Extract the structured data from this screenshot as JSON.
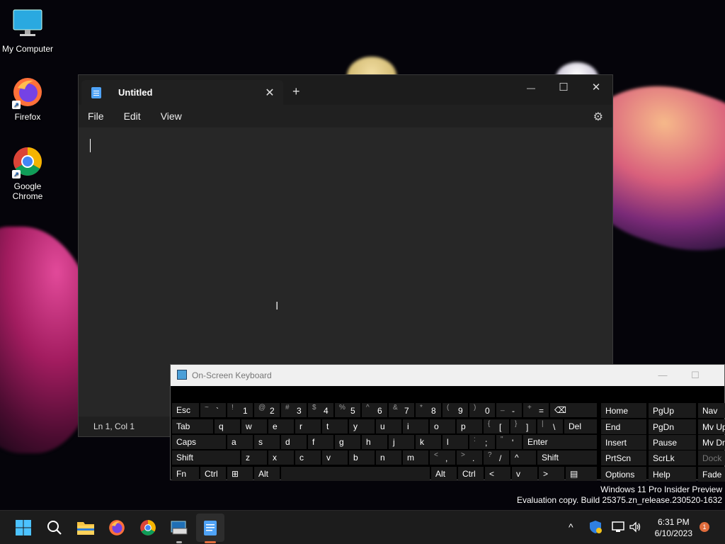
{
  "colors": {
    "accent": "#4fa3f7",
    "taskbar": "#1c1c1c",
    "notepad_bg": "#202020",
    "osk_key": "#1b1b1b"
  },
  "desktop": {
    "icons": [
      {
        "label": "My Computer",
        "icon": "monitor-icon"
      },
      {
        "label": "Firefox",
        "icon": "firefox-icon"
      },
      {
        "label": "Google Chrome",
        "icon": "chrome-icon"
      }
    ]
  },
  "notepad": {
    "tab_title": "Untitled",
    "tab_close": "✕",
    "new_tab": "+",
    "window_controls": {
      "minimize": "—",
      "maximize": "☐",
      "close": "✕"
    },
    "menu": [
      "File",
      "Edit",
      "View"
    ],
    "settings_icon": "⚙",
    "status": "Ln 1, Col 1"
  },
  "osk": {
    "title": "On-Screen Keyboard",
    "title_buttons": {
      "minimize": "—",
      "maximize": "☐"
    },
    "rows": {
      "r1": [
        {
          "main": "Esc"
        },
        {
          "shift": "~",
          "low": "`"
        },
        {
          "shift": "!",
          "low": "1"
        },
        {
          "shift": "@",
          "low": "2"
        },
        {
          "shift": "#",
          "low": "3"
        },
        {
          "shift": "$",
          "low": "4"
        },
        {
          "shift": "%",
          "low": "5"
        },
        {
          "shift": "^",
          "low": "6"
        },
        {
          "shift": "&",
          "low": "7"
        },
        {
          "shift": "*",
          "low": "8"
        },
        {
          "shift": "(",
          "low": "9"
        },
        {
          "shift": ")",
          "low": "0"
        },
        {
          "shift": "_",
          "low": "-"
        },
        {
          "shift": "+",
          "low": "="
        },
        {
          "main": "⌫"
        }
      ],
      "r2": [
        {
          "main": "Tab"
        },
        {
          "main": "q"
        },
        {
          "main": "w"
        },
        {
          "main": "e"
        },
        {
          "main": "r"
        },
        {
          "main": "t"
        },
        {
          "main": "y"
        },
        {
          "main": "u"
        },
        {
          "main": "i"
        },
        {
          "main": "o"
        },
        {
          "main": "p"
        },
        {
          "shift": "{",
          "low": "["
        },
        {
          "shift": "}",
          "low": "]"
        },
        {
          "shift": "|",
          "low": "\\"
        },
        {
          "main": "Del"
        }
      ],
      "r3": [
        {
          "main": "Caps"
        },
        {
          "main": "a"
        },
        {
          "main": "s"
        },
        {
          "main": "d"
        },
        {
          "main": "f"
        },
        {
          "main": "g"
        },
        {
          "main": "h"
        },
        {
          "main": "j"
        },
        {
          "main": "k"
        },
        {
          "main": "l"
        },
        {
          "shift": ":",
          "low": ";"
        },
        {
          "shift": "\"",
          "low": "'"
        },
        {
          "main": "Enter"
        }
      ],
      "r4": [
        {
          "main": "Shift"
        },
        {
          "main": "z"
        },
        {
          "main": "x"
        },
        {
          "main": "c"
        },
        {
          "main": "v"
        },
        {
          "main": "b"
        },
        {
          "main": "n"
        },
        {
          "main": "m"
        },
        {
          "shift": "<",
          "low": ","
        },
        {
          "shift": ">",
          "low": "."
        },
        {
          "shift": "?",
          "low": "/"
        },
        {
          "main": "^"
        },
        {
          "main": "Shift"
        }
      ],
      "r5": [
        {
          "main": "Fn"
        },
        {
          "main": "Ctrl"
        },
        {
          "main": "⊞"
        },
        {
          "main": "Alt"
        },
        {
          "main": ""
        },
        {
          "main": "Alt"
        },
        {
          "main": "Ctrl"
        },
        {
          "main": "<"
        },
        {
          "main": "v"
        },
        {
          "main": ">"
        },
        {
          "main": "▤"
        }
      ]
    },
    "nav_keys": [
      [
        "Home",
        "PgUp",
        "Nav"
      ],
      [
        "End",
        "PgDn",
        "Mv Up"
      ],
      [
        "Insert",
        "Pause",
        "Mv Dn"
      ],
      [
        "PrtScn",
        "ScrLk",
        "Dock"
      ],
      [
        "Options",
        "Help",
        "Fade"
      ]
    ]
  },
  "watermark": {
    "line1": "Windows 11 Pro Insider Preview",
    "line2": "Evaluation copy. Build 25375.zn_release.230520-1632"
  },
  "taskbar": {
    "apps": [
      "start-icon",
      "search-icon",
      "file-explorer-icon",
      "firefox-icon",
      "chrome-icon",
      "osk-icon",
      "notepad-icon"
    ],
    "tray": {
      "chevron": "^",
      "time": "6:31 PM",
      "date": "6/10/2023",
      "notifications": "1"
    }
  }
}
